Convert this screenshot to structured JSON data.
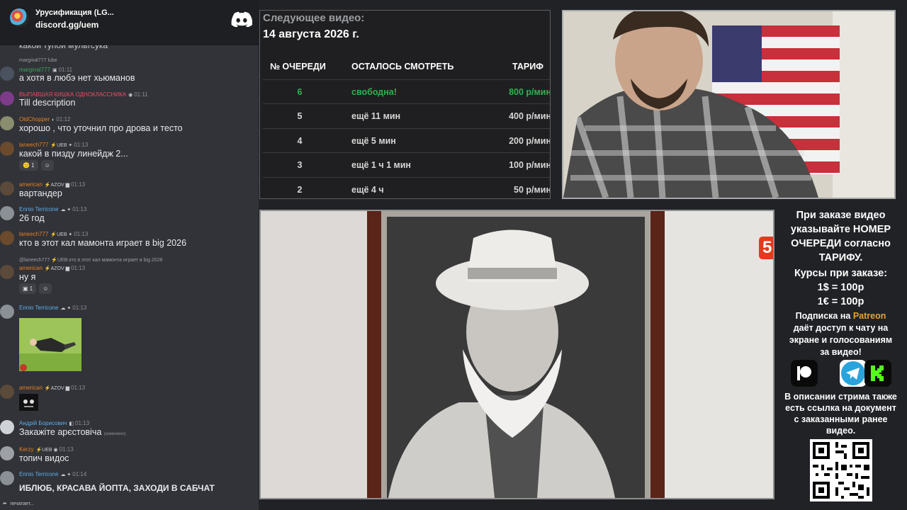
{
  "chat": {
    "server": {
      "name": "Урусификация (LG...",
      "invite": "discord.gg/uem"
    },
    "clipped_top": "какой тупой мультсука",
    "messages": [
      {
        "reply": "marginal777 lube",
        "author": "marginal777",
        "author_color": "#3ba55d",
        "badges": "▣",
        "time": "01:11",
        "text": "а хотя в любэ нет хьюманов"
      },
      {
        "author": "ВЫПАВШАЯ КИШКА ОДНОКЛАССНИКА",
        "author_color": "#ed4b61",
        "badges": "◉",
        "time": "01:11",
        "text": "Till description"
      },
      {
        "author": "OldChopper",
        "author_color": "#e67e22",
        "badges": "◐",
        "time": "01:12",
        "text": "хорошо , что уточнил про дрова и тесто"
      },
      {
        "author": "laneech777",
        "author_color": "#e67e22",
        "badges": "⚡UEB ✦",
        "time": "01:13",
        "text": "какой в пизду линейдж 2...",
        "reactions": [
          "🙁 1",
          "☺"
        ]
      },
      {
        "author": "american",
        "author_color": "#e67e22",
        "badges": "⚡AZOV ▆",
        "time": "01:13",
        "text": "вартандер"
      },
      {
        "author": "Ennio Terricone",
        "author_color": "#5dadec",
        "badges": "☁ ✦",
        "time": "01:13",
        "text": "26 год"
      },
      {
        "author": "laneech777",
        "author_color": "#e67e22",
        "badges": "⚡UEB ✦",
        "time": "01:13",
        "text": "кто в этот кал мамонта играет в big 2026"
      },
      {
        "reply": "@laneech777 ⚡UEB кто в этот кал мамонта играет в big 2026",
        "author": "american",
        "author_color": "#e67e22",
        "badges": "⚡AZOV ▆",
        "time": "01:13",
        "text": "ну я",
        "reactions": [
          "▣ 1",
          "☺"
        ]
      },
      {
        "author": "Ennio Terricone",
        "author_color": "#5dadec",
        "badges": "☁ ✦",
        "time": "01:13",
        "text": ""
      },
      {
        "author": "american",
        "author_color": "#e67e22",
        "badges": "⚡AZOV ▆",
        "time": "01:13",
        "text": ""
      },
      {
        "author": "Андрій Борисович",
        "author_color": "#5dadec",
        "badges": "◧",
        "time": "01:13",
        "text": "Закажіте арєстовіча",
        "edited": "(изменено)"
      },
      {
        "author": "Kerzy",
        "author_color": "#e67e22",
        "badges": "⚡UEB ◉",
        "time": "01:13",
        "text": "топич видос"
      },
      {
        "author": "Ennio Terricone",
        "author_color": "#5dadec",
        "badges": "☁ ✦",
        "time": "01:14",
        "text": "ИБЛЮБ, КРАСАВА ЙОПТА, ЗАХОДИ В САБЧАТ"
      }
    ],
    "typing": "печатает..."
  },
  "schedule": {
    "label": "Следующее видео:",
    "date": "14 августа 2026 г.",
    "headers": [
      "№ ОЧЕРЕДИ",
      "ОСТАЛОСЬ СМОТРЕТЬ",
      "ТАРИФ"
    ],
    "rows": [
      {
        "queue": "6",
        "remaining": "свободна!",
        "rate": "800 р/мин"
      },
      {
        "queue": "5",
        "remaining": "ещё 11 мин",
        "rate": "400 р/мин"
      },
      {
        "queue": "4",
        "remaining": "ещё 5 мин",
        "rate": "200 р/мин"
      },
      {
        "queue": "3",
        "remaining": "ещё 1 ч 1 мин",
        "rate": "100 р/мин"
      },
      {
        "queue": "2",
        "remaining": "ещё 4 ч",
        "rate": "50 р/мин"
      }
    ]
  },
  "video": {
    "channel_badge": "5"
  },
  "info": {
    "order_line1": "При заказе видео",
    "order_line2": "указывайте НОМЕР",
    "order_line3": "ОЧЕРЕДИ согласно",
    "order_line4": "ТАРИФУ.",
    "rates_label": "Курсы при заказе:",
    "rate_usd": "1$ = 100р",
    "rate_eur": "1€ = 100р",
    "patreon_pre": "Подписка на",
    "patreon": "Patreon",
    "patreon_line2": "даёт доступ к чату на",
    "patreon_line3": "экране и голосованиям",
    "patreon_line4": "за видео!",
    "desc_line1": "В описании стрима также",
    "desc_line2": "есть ссылка на документ",
    "desc_line3": "с заказанными ранее",
    "desc_line4": "видео."
  }
}
